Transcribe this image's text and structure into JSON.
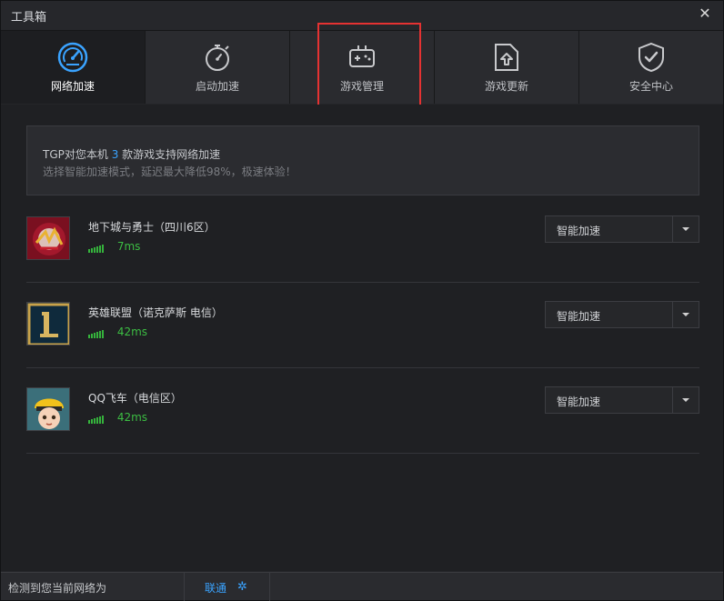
{
  "window": {
    "title": "工具箱",
    "close_label": "✕"
  },
  "tabs": [
    {
      "label": "网络加速",
      "icon": "speedometer-icon",
      "active": true
    },
    {
      "label": "启动加速",
      "icon": "stopwatch-icon",
      "active": false
    },
    {
      "label": "游戏管理",
      "icon": "gamepad-icon",
      "active": false
    },
    {
      "label": "游戏更新",
      "icon": "folder-upload-icon",
      "active": false
    },
    {
      "label": "安全中心",
      "icon": "shield-check-icon",
      "active": false
    }
  ],
  "info": {
    "prefix": "TGP对您本机",
    "count": "3",
    "suffix": "款游戏支持网络加速",
    "subtitle": "选择智能加速模式，延迟最大降低98%，极速体验！"
  },
  "games": [
    {
      "name": "地下城与勇士（四川6区）",
      "ping": "7ms",
      "mode": "智能加速",
      "icon": "dnf-game-icon"
    },
    {
      "name": "英雄联盟（诺克萨斯 电信）",
      "ping": "42ms",
      "mode": "智能加速",
      "icon": "lol-game-icon"
    },
    {
      "name": "QQ飞车（电信区）",
      "ping": "42ms",
      "mode": "智能加速",
      "icon": "qq-speed-game-icon"
    }
  ],
  "status": {
    "network_label": "检测到您当前网络为",
    "isp": "联通",
    "settings_icon": "gear-icon"
  },
  "colors": {
    "accent_blue": "#3aa3ff",
    "ping_green": "#3cbd43",
    "highlight_red": "#e53232"
  }
}
